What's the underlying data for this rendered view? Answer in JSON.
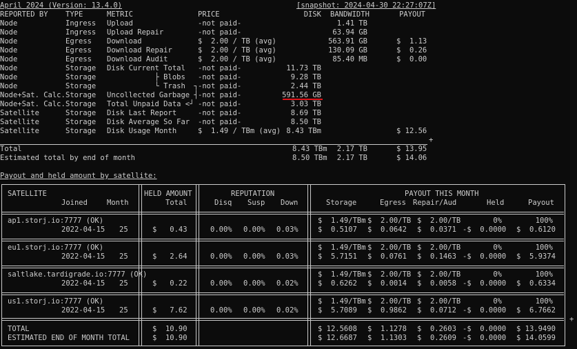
{
  "header": {
    "title": "April 2024 (Version: 13.4.0)",
    "snapshot": "[snapshot: 2024-04-30 22:27:07Z]"
  },
  "earnings": {
    "columns": [
      "REPORTED BY",
      "TYPE",
      "METRIC",
      "PRICE",
      "DISK",
      "BANDWIDTH",
      "PAYOUT"
    ],
    "rows": [
      {
        "by": "Node",
        "type": "Ingress",
        "metric": "Upload",
        "price": "-not paid-",
        "disk": "",
        "bw": "1.41 TB",
        "payout": ""
      },
      {
        "by": "Node",
        "type": "Ingress",
        "metric": "Upload Repair",
        "price": "-not paid-",
        "disk": "",
        "bw": "63.94 GB",
        "payout": ""
      },
      {
        "by": "Node",
        "type": "Egress",
        "metric": "Download",
        "price": "$  2.00 / TB (avg)",
        "disk": "",
        "bw": "563.91 GB",
        "payout": "$  1.13"
      },
      {
        "by": "Node",
        "type": "Egress",
        "metric": "Download Repair",
        "price": "$  2.00 / TB (avg)",
        "disk": "",
        "bw": "130.09 GB",
        "payout": "$  0.26"
      },
      {
        "by": "Node",
        "type": "Egress",
        "metric": "Download Audit",
        "price": "$  2.00 / TB (avg)",
        "disk": "",
        "bw": "85.40 MB",
        "payout": "$  0.00"
      },
      {
        "by": "Node",
        "type": "Storage",
        "metric": "Disk Current Total",
        "price": "-not paid-",
        "disk": "11.73 TB",
        "bw": "",
        "payout": ""
      },
      {
        "by": "Node",
        "type": "Storage",
        "metric": "           ├ Blobs",
        "price": "-not paid-",
        "disk": "9.28 TB",
        "bw": "",
        "payout": ""
      },
      {
        "by": "Node",
        "type": "Storage",
        "metric": "           └ Trash  ┐",
        "price": "-not paid-",
        "disk": "2.44 TB",
        "bw": "",
        "payout": ""
      },
      {
        "by": "Node+Sat. Calc.",
        "type": "Storage",
        "metric": "Uncollected Garbage ┤",
        "price": "-not paid-",
        "disk": "591.56 GB",
        "bw": "",
        "payout": ""
      },
      {
        "by": "Node+Sat. Calc.",
        "type": "Storage",
        "metric": "Total Unpaid Data <┘",
        "price": "-not paid-",
        "disk": "3.03 TB",
        "bw": "",
        "payout": ""
      },
      {
        "by": "Satellite",
        "type": "Storage",
        "metric": "Disk Last Report",
        "price": "-not paid-",
        "disk": "8.69 TB",
        "bw": "",
        "payout": ""
      },
      {
        "by": "Satellite",
        "type": "Storage",
        "metric": "Disk Average So Far",
        "price": "-not paid-",
        "disk": "8.50 TB",
        "bw": "",
        "payout": ""
      },
      {
        "by": "Satellite",
        "type": "Storage",
        "metric": "Disk Usage Month",
        "price": "$  1.49 / TBm (avg)",
        "disk": "8.43 TBm",
        "bw": "",
        "payout": "$ 12.56"
      }
    ],
    "plus_sign": "+",
    "totals": [
      {
        "label": "Total",
        "disk": "8.43 TBm",
        "bw": "2.17 TB",
        "payout": "$ 13.95"
      },
      {
        "label": "Estimated total by end of month",
        "disk": "8.50 TBm",
        "bw": "2.17 TB",
        "payout": "$ 14.06"
      }
    ]
  },
  "payout_section": {
    "title": "Payout and held amount by satellite:",
    "headers": {
      "satellite": "SATELLITE",
      "joined": "Joined",
      "month": "Month",
      "held_amount": "HELD AMOUNT",
      "held_total": "Total",
      "reputation": "REPUTATION",
      "disq": "Disq",
      "susp": "Susp",
      "down": "Down",
      "payout_month": "PAYOUT THIS MONTH",
      "storage": "Storage",
      "egress": "Egress",
      "repair": "Repair/Aud",
      "held": "Held",
      "payout": "Payout"
    },
    "satellites": [
      {
        "name": "ap1.storj.io:7777 (OK)",
        "joined": "2022-04-15",
        "month": "25",
        "held_total": "$   0.43",
        "disq": "0.00%",
        "susp": "0.00%",
        "down": "0.03%",
        "storage_rate": "$  1.49/TBm",
        "egress_rate": "$  2.00/TB",
        "repair_rate": "$  2.00/TB",
        "held_pct": "0%",
        "payout_pct": "100%",
        "storage": "$  0.5107",
        "egress": "$  0.0642",
        "repair": "$  0.0371",
        "held": "-$  0.0000",
        "payout": "$  0.6120"
      },
      {
        "name": "eu1.storj.io:7777 (OK)",
        "joined": "2022-04-15",
        "month": "25",
        "held_total": "$   2.64",
        "disq": "0.00%",
        "susp": "0.00%",
        "down": "0.03%",
        "storage_rate": "$  1.49/TBm",
        "egress_rate": "$  2.00/TB",
        "repair_rate": "$  2.00/TB",
        "held_pct": "0%",
        "payout_pct": "100%",
        "storage": "$  5.7151",
        "egress": "$  0.0761",
        "repair": "$  0.1463",
        "held": "-$  0.0000",
        "payout": "$  5.9374"
      },
      {
        "name": "saltlake.tardigrade.io:7777 (OK)",
        "joined": "2022-04-15",
        "month": "25",
        "held_total": "$   0.22",
        "disq": "0.00%",
        "susp": "0.00%",
        "down": "0.02%",
        "storage_rate": "$  1.49/TBm",
        "egress_rate": "$  2.00/TB",
        "repair_rate": "$  2.00/TB",
        "held_pct": "0%",
        "payout_pct": "100%",
        "storage": "$  0.6262",
        "egress": "$  0.0014",
        "repair": "$  0.0058",
        "held": "-$  0.0000",
        "payout": "$  0.6334"
      },
      {
        "name": "us1.storj.io:7777 (OK)",
        "joined": "2022-04-15",
        "month": "25",
        "held_total": "$   7.62",
        "disq": "0.00%",
        "susp": "0.00%",
        "down": "0.02%",
        "storage_rate": "$  1.49/TBm",
        "egress_rate": "$  2.00/TB",
        "repair_rate": "$  2.00/TB",
        "held_pct": "0%",
        "payout_pct": "100%",
        "storage": "$  5.7089",
        "egress": "$  0.9862",
        "repair": "$  0.0712",
        "held": "-$  0.0000",
        "payout": "$  6.7662"
      }
    ],
    "totals": [
      {
        "label": "TOTAL",
        "held_total": "$  10.90",
        "storage": "$ 12.5608",
        "egress": "$  1.1278",
        "repair": "$  0.2603",
        "held": "-$  0.0000",
        "payout": "$ 13.9490"
      },
      {
        "label": "ESTIMATED END OF MONTH TOTAL",
        "held_total": "$  10.90",
        "storage": "$ 12.6687",
        "egress": "$  1.1303",
        "repair": "$  0.2609",
        "held": "-$  0.0000",
        "payout": "$ 14.0599"
      }
    ],
    "plus_sign": "+"
  },
  "colors": {
    "background": "#0c0c0c",
    "text": "#cccccc",
    "highlight": "#e0161b"
  }
}
